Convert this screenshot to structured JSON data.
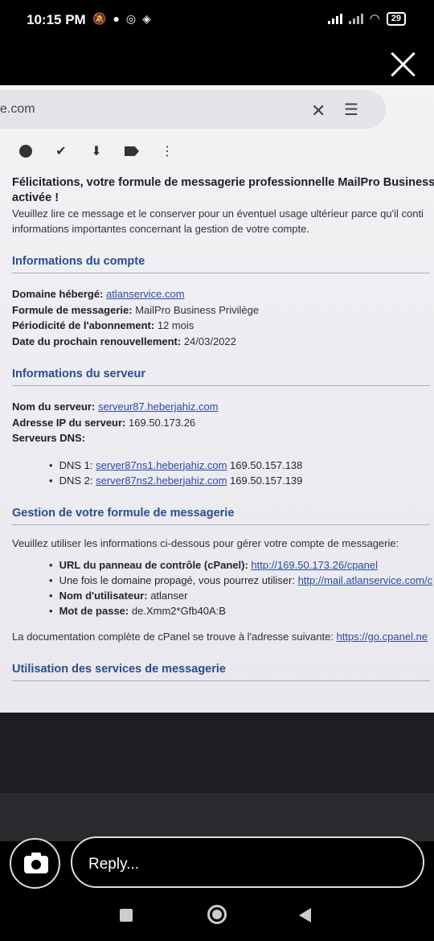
{
  "status_bar": {
    "time": "10:15 PM",
    "left_icons": [
      "mute-icon",
      "chat-icon",
      "location-icon",
      "nfc-icon"
    ],
    "battery": "29"
  },
  "viewer": {
    "close": "close-icon"
  },
  "browser": {
    "domain_fragment": "e.com",
    "toolbar_icons": [
      "snooze-icon",
      "add-task-icon",
      "move-to-inbox-icon",
      "label-icon",
      "more-icon"
    ]
  },
  "email": {
    "headline1": "Félicitations, votre formule de messagerie professionnelle MailPro Business",
    "headline2": "activée !",
    "intro1": "Veuillez lire ce message et le conserver pour un éventuel usage ultérieur parce qu'il conti",
    "intro2": "informations importantes concernant la gestion de votre compte.",
    "account": {
      "title": "Informations du compte",
      "domain_label": "Domaine hébergé:",
      "domain_value": "atlanservice.com",
      "plan_label": "Formule de messagerie:",
      "plan_value": "MailPro Business Privilège",
      "period_label": "Périodicité de l'abonnement:",
      "period_value": "12 mois",
      "renewal_label": "Date du prochain renouvellement:",
      "renewal_value": "24/03/2022"
    },
    "server": {
      "title": "Informations du serveur",
      "name_label": "Nom du serveur:",
      "name_value": "serveur87.heberjahiz.com",
      "ip_label": "Adresse IP du serveur:",
      "ip_value": "169.50.173.26",
      "dns_label": "Serveurs DNS:",
      "dns": [
        {
          "label": "DNS 1:",
          "host": "server87ns1.heberjahiz.com",
          "ip": "169.50.157.138"
        },
        {
          "label": "DNS 2:",
          "host": "server87ns2.heberjahiz.com",
          "ip": "169.50.157.139"
        }
      ]
    },
    "manage": {
      "title": "Gestion de votre formule de messagerie",
      "intro": "Veuillez utiliser les informations ci-dessous pour gérer votre compte de messagerie:",
      "cpanel_label": "URL du panneau de contrôle (cPanel):",
      "cpanel_url": "http://169.50.173.26/cpanel",
      "propagated_text": "Une fois le domaine propagé, vous pourrez utiliser:",
      "propagated_url": "http://mail.atlanservice.com/c",
      "user_label": "Nom d'utilisateur:",
      "user_value": "atlanser",
      "pass_label": "Mot de passe:",
      "pass_value": "de.Xmm2*Gfb40A:B",
      "doc_text": "La documentation complète de cPanel se trouve à l'adresse suivante:",
      "doc_url": "https://go.cpanel.ne"
    },
    "usage_title": "Utilisation des services de messagerie"
  },
  "reply": {
    "placeholder": "Reply..."
  }
}
